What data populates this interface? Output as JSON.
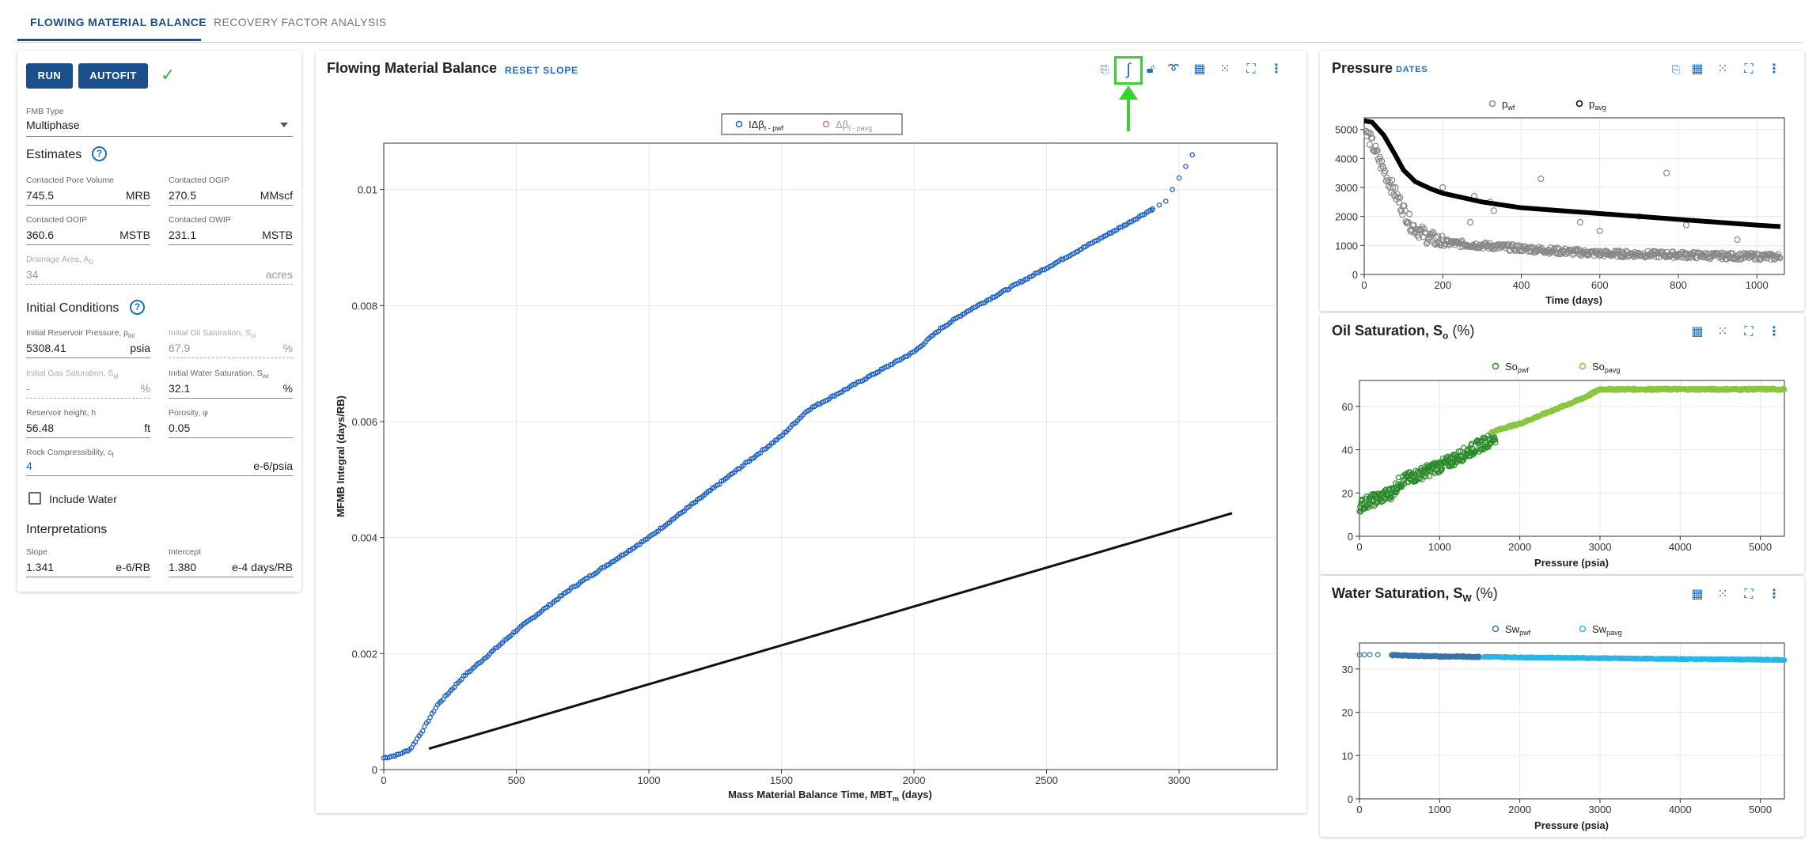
{
  "tabs": [
    {
      "label": "FLOWING MATERIAL BALANCE",
      "active": true
    },
    {
      "label": "RECOVERY FACTOR ANALYSIS",
      "active": false
    }
  ],
  "left_panel": {
    "run_label": "RUN",
    "autofit_label": "AUTOFIT",
    "fmb_type_label": "FMB Type",
    "fmb_type_value": "Multiphase",
    "estimates_title": "Estimates",
    "estimates": {
      "pore_volume": {
        "label": "Contacted Pore Volume",
        "value": "745.5",
        "unit": "MRB"
      },
      "ogip": {
        "label": "Contacted OGIP",
        "value": "270.5",
        "unit": "MMscf"
      },
      "ooip": {
        "label": "Contacted OOIP",
        "value": "360.6",
        "unit": "MSTB"
      },
      "owip": {
        "label": "Contacted OWIP",
        "value": "231.1",
        "unit": "MSTB"
      },
      "drainage": {
        "label": "Drainage Area, A",
        "label_sub": "D",
        "value": "34",
        "unit": "acres"
      }
    },
    "initial_title": "Initial Conditions",
    "initial": {
      "pressure": {
        "label": "Initial Reservoir Pressure, p",
        "label_sub": "ini",
        "value": "5308.41",
        "unit": "psia"
      },
      "oil_sat": {
        "label": "Initial Oil Saturation, S",
        "label_sub": "oi",
        "value": "67.9",
        "unit": "%"
      },
      "gas_sat": {
        "label": "Initial Gas Saturation, S",
        "label_sub": "gi",
        "value": "-",
        "unit": "%"
      },
      "water_sat": {
        "label": "Initial Water Saturation, S",
        "label_sub": "wi",
        "value": "32.1",
        "unit": "%"
      },
      "height": {
        "label": "Reservoir height, h",
        "value": "56.48",
        "unit": "ft"
      },
      "porosity": {
        "label": "Porosity, φ",
        "value": "0.05",
        "unit": ""
      },
      "compress": {
        "label": "Rock Compressibility, c",
        "label_sub": "f",
        "value": "4",
        "unit": "e-6/psia"
      }
    },
    "include_water_label": "Include Water",
    "interp_title": "Interpretations",
    "interp": {
      "slope": {
        "label": "Slope",
        "value": "1.341",
        "unit": "e-6/RB"
      },
      "intercept": {
        "label": "Intercept",
        "value": "1.380",
        "unit": "e-4 days/RB"
      }
    }
  },
  "main_chart": {
    "title": "Flowing Material Balance",
    "reset_label": "RESET SLOPE",
    "toolbar_icons": [
      "paste-icon",
      "integral-icon",
      "unlock-icon",
      "lasso-icon",
      "table-icon",
      "scatter-icon",
      "expand-icon",
      "more-icon"
    ]
  },
  "pressure_panel": {
    "title": "Pressure",
    "dates_label": "DATES"
  },
  "oil_panel": {
    "title": "Oil Saturation, S",
    "title_sub": "o",
    "title_unit": " (%)"
  },
  "water_panel": {
    "title": "Water Saturation, S",
    "title_sub": "W",
    "title_unit": " (%)"
  },
  "colors": {
    "primary": "#1a4f8b",
    "link": "#1a6fc0",
    "highlight": "#3ad132",
    "fmb_series": "#1a5fc4",
    "so_pwf": "#2a8a2a",
    "so_pavg": "#8bc53f",
    "sw_pwf": "#3a73a8",
    "sw_pavg": "#29b6e8"
  },
  "chart_data": [
    {
      "id": "fmb",
      "type": "scatter",
      "xlabel": "Mass Material Balance Time, MBT",
      "xlabel_sub": "m",
      "xlabel_unit": " (days)",
      "ylabel": "MFMB Integral (days/RB)",
      "xlim": [
        0,
        3370
      ],
      "ylim": [
        0,
        0.0108
      ],
      "xticks": [
        0,
        500,
        1000,
        1500,
        2000,
        2500,
        3000
      ],
      "yticks": [
        0,
        0.002,
        0.004,
        0.006,
        0.008,
        0.01
      ],
      "ytick_labels": [
        "0",
        "0.002",
        "0.004",
        "0.006",
        "0.008",
        "0.01"
      ],
      "legend": [
        {
          "name": "IΔβ",
          "sub": "t - pwf",
          "color": "#1a5fc4"
        },
        {
          "name": "Δβ",
          "sub": "t - pavg",
          "color": "#c070c0"
        }
      ],
      "series_curve": {
        "name": "IΔβt - pwf",
        "x": [
          0,
          50,
          100,
          150,
          200,
          300,
          400,
          500,
          600,
          700,
          800,
          1000,
          1200,
          1400,
          1500,
          1600,
          1800,
          2000,
          2100,
          2200,
          2400,
          2600,
          2800,
          2950,
          3050
        ],
        "y": [
          0.0002,
          0.00025,
          0.00035,
          0.0007,
          0.0011,
          0.0016,
          0.002,
          0.0024,
          0.00275,
          0.0031,
          0.0034,
          0.004,
          0.0047,
          0.0054,
          0.00575,
          0.0062,
          0.0067,
          0.0072,
          0.0076,
          0.0079,
          0.0084,
          0.0089,
          0.0094,
          0.0098,
          0.0106
        ]
      },
      "fit_line": {
        "x": [
          170,
          3200
        ],
        "y": [
          0.00036,
          0.00442
        ]
      }
    },
    {
      "id": "pressure",
      "type": "scatter",
      "xlabel": "Time (days)",
      "xlim": [
        0,
        1070
      ],
      "ylim": [
        0,
        5400
      ],
      "xticks": [
        0,
        200,
        400,
        600,
        800,
        1000
      ],
      "yticks": [
        0,
        1000,
        2000,
        3000,
        4000,
        5000
      ],
      "legend": [
        {
          "name": "p",
          "sub": "wf",
          "color": "#888888"
        },
        {
          "name": "p",
          "sub": "avg",
          "color": "#000000"
        }
      ],
      "pavg": {
        "x": [
          0,
          20,
          50,
          80,
          100,
          130,
          170,
          200,
          300,
          400,
          500,
          600,
          700,
          800,
          900,
          1000,
          1060
        ],
        "y": [
          5300,
          5250,
          4800,
          4100,
          3600,
          3200,
          2950,
          2800,
          2500,
          2300,
          2200,
          2100,
          2000,
          1900,
          1800,
          1700,
          1650
        ]
      },
      "pwf_trend": {
        "x": [
          10,
          30,
          60,
          90,
          120,
          160,
          200,
          250,
          300,
          400,
          500,
          600,
          700,
          800,
          900,
          1000,
          1060
        ],
        "y": [
          4800,
          4200,
          3300,
          2500,
          1700,
          1300,
          1100,
          1050,
          1000,
          900,
          800,
          720,
          700,
          680,
          640,
          620,
          600
        ]
      }
    },
    {
      "id": "oil_saturation",
      "type": "scatter",
      "xlabel": "Pressure (psia)",
      "xlim": [
        0,
        5300
      ],
      "ylim": [
        0,
        72
      ],
      "xticks": [
        0,
        1000,
        2000,
        3000,
        4000,
        5000
      ],
      "yticks": [
        0,
        20,
        40,
        60
      ],
      "legend": [
        {
          "name": "So",
          "sub": "pwf",
          "color": "#2a8a2a"
        },
        {
          "name": "So",
          "sub": "pavg",
          "color": "#8bc53f"
        }
      ],
      "so_pwf": {
        "x": [
          0,
          100,
          200,
          400,
          500,
          700,
          900,
          1100,
          1300,
          1500,
          1700
        ],
        "y": [
          14,
          16,
          17,
          20,
          25,
          28,
          31,
          34,
          38,
          42,
          46
        ]
      },
      "so_pavg": {
        "x": [
          1650,
          1800,
          2000,
          2200,
          2400,
          2600,
          2800,
          3000,
          3500,
          4000,
          4500,
          5000,
          5300
        ],
        "y": [
          48,
          50,
          52,
          55,
          58,
          61,
          64,
          67.9,
          67.9,
          67.9,
          67.9,
          67.9,
          67.9
        ]
      }
    },
    {
      "id": "water_saturation",
      "type": "scatter",
      "xlabel": "Pressure (psia)",
      "xlim": [
        0,
        5300
      ],
      "ylim": [
        0,
        36
      ],
      "xticks": [
        0,
        1000,
        2000,
        3000,
        4000,
        5000
      ],
      "yticks": [
        0,
        10,
        20,
        30
      ],
      "legend": [
        {
          "name": "Sw",
          "sub": "pwf",
          "color": "#3a73a8"
        },
        {
          "name": "Sw",
          "sub": "pavg",
          "color": "#29b6e8"
        }
      ],
      "sw_pwf": {
        "x": [
          0,
          300,
          400,
          600,
          800,
          1000,
          1200,
          1500
        ],
        "y": [
          33.3,
          33.3,
          33.2,
          33.1,
          33.0,
          32.9,
          32.9,
          32.8
        ]
      },
      "sw_pavg": {
        "x": [
          1600,
          2000,
          2500,
          3000,
          3500,
          4000,
          4500,
          5000,
          5300
        ],
        "y": [
          32.8,
          32.7,
          32.6,
          32.5,
          32.4,
          32.3,
          32.25,
          32.15,
          32.1
        ]
      }
    }
  ]
}
